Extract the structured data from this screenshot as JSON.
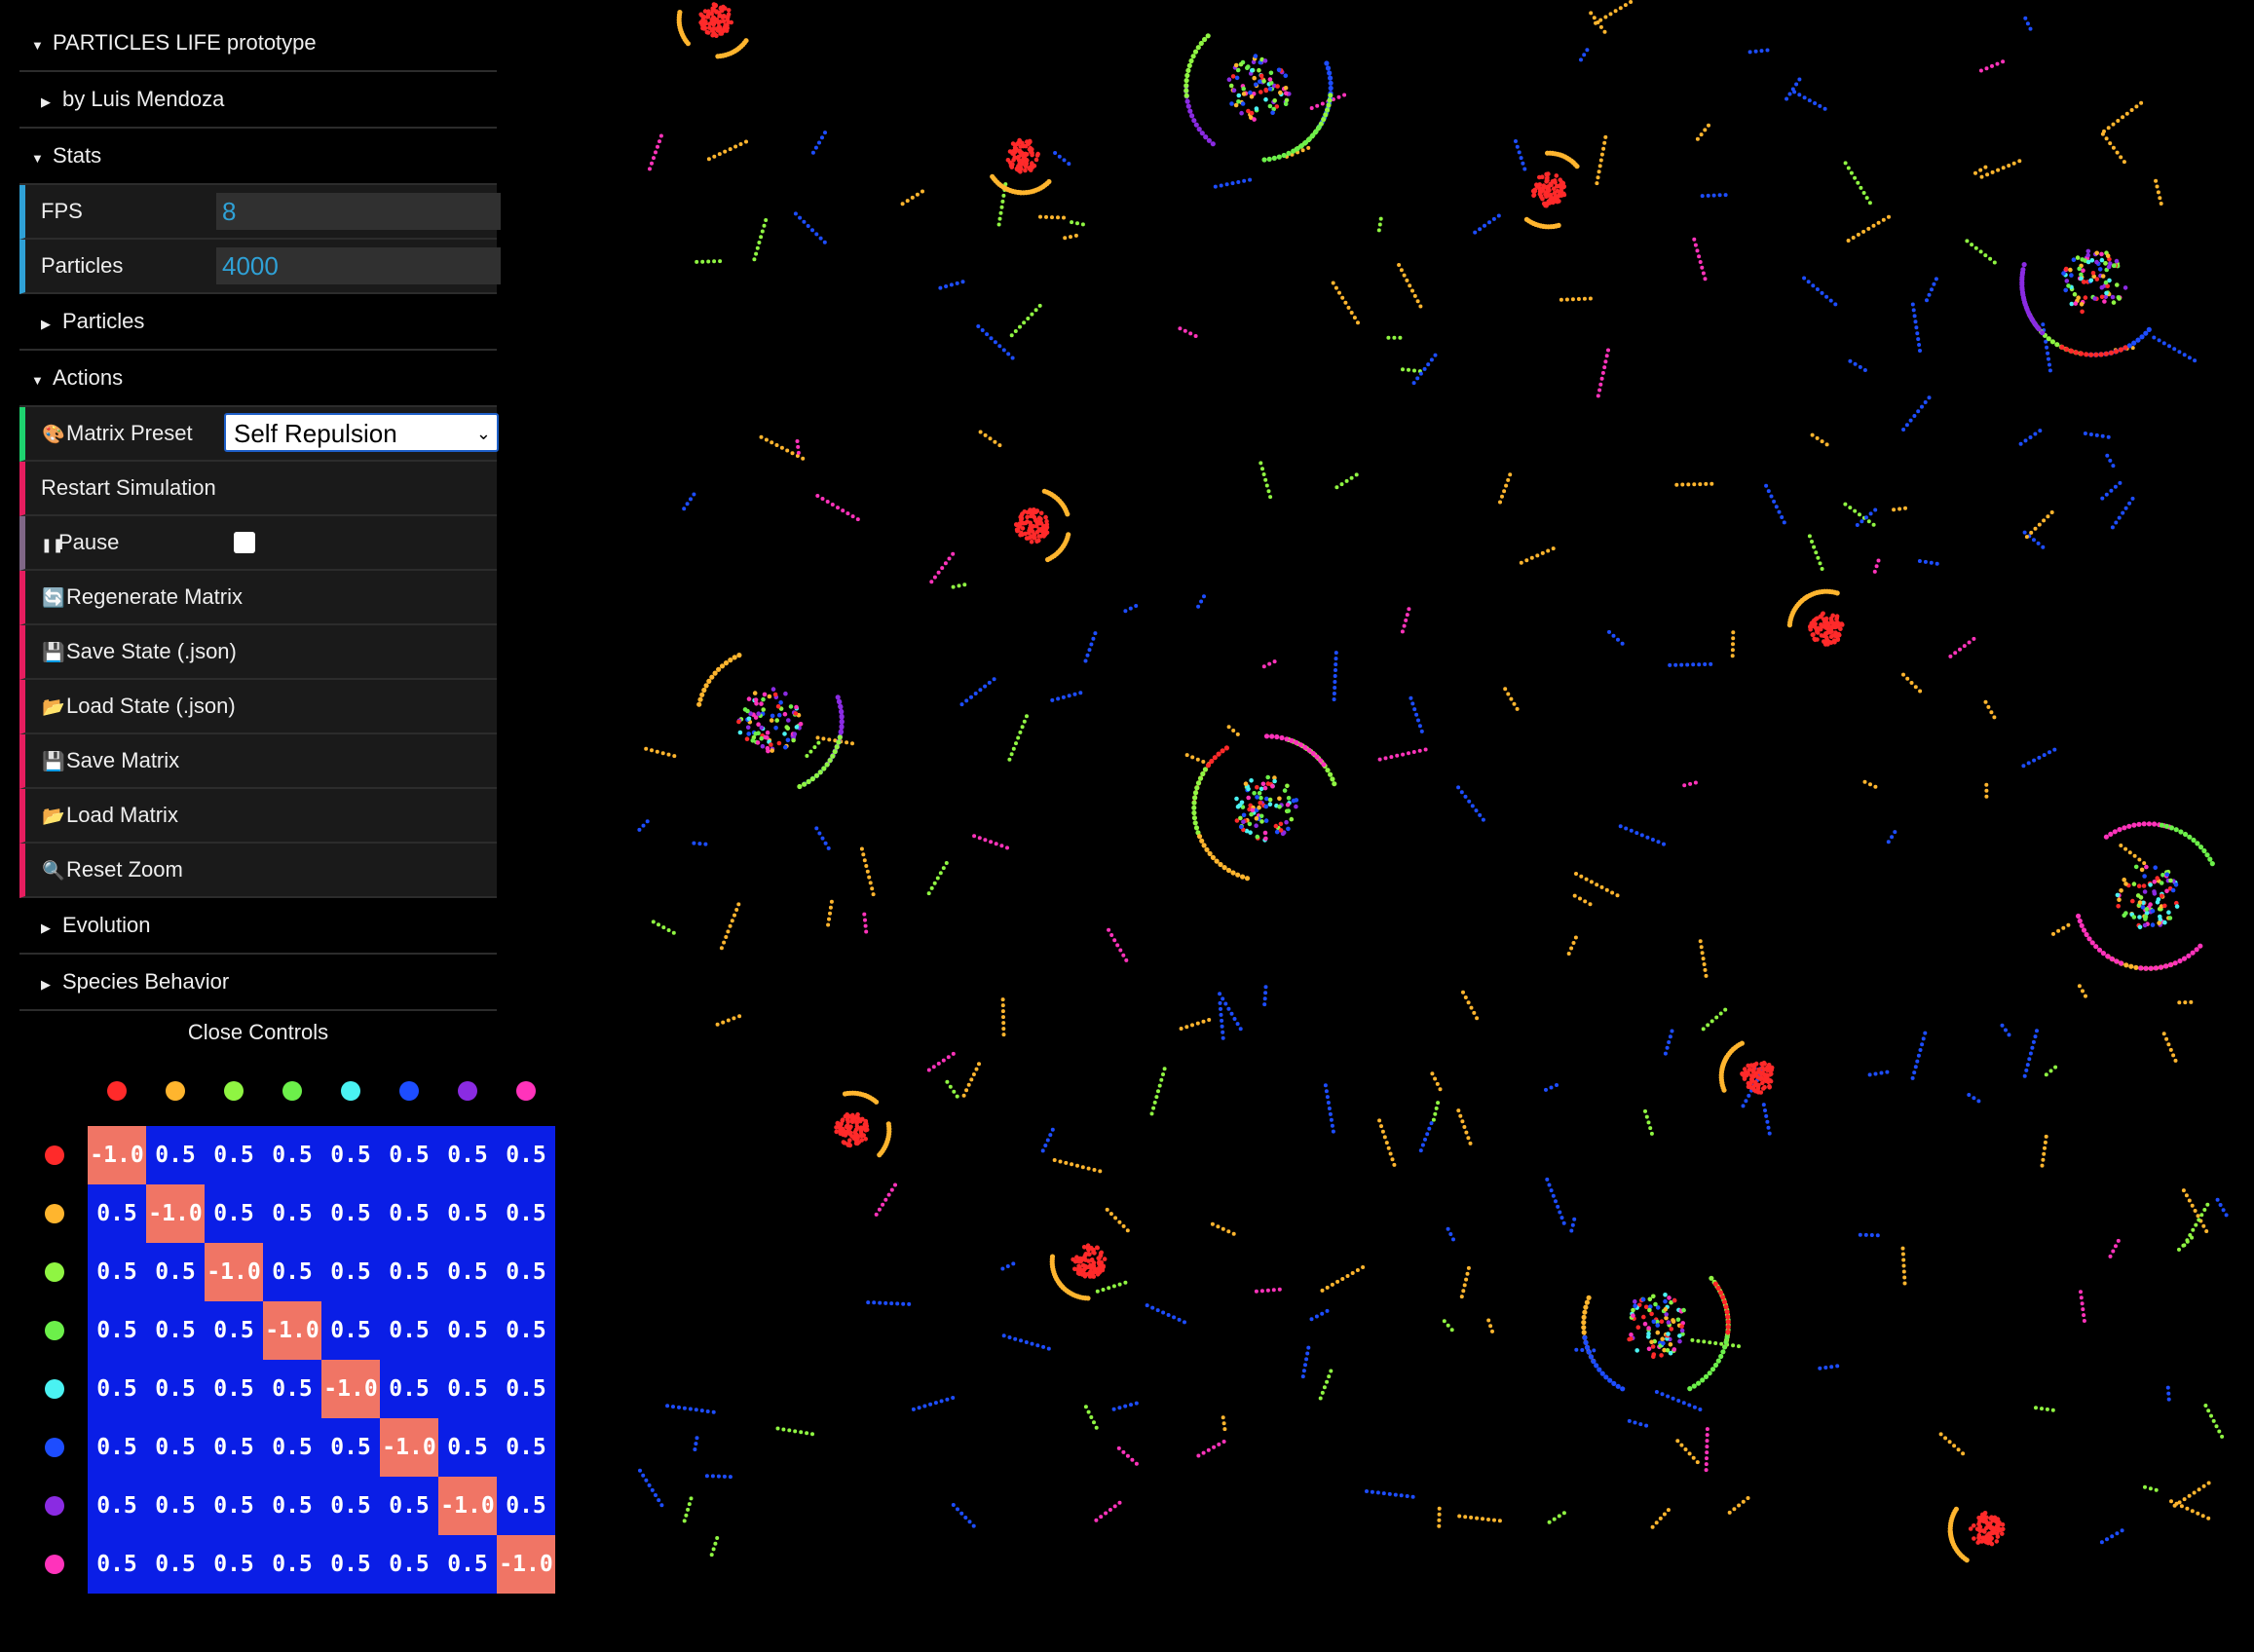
{
  "gui": {
    "title": "PARTICLES LIFE prototype",
    "author": "by Luis Mendoza",
    "stats": {
      "title": "Stats",
      "fps_label": "FPS",
      "fps_value": "8",
      "particles_label": "Particles",
      "particles_value": "4000"
    },
    "particles_folder": "Particles",
    "actions": {
      "title": "Actions",
      "matrix_preset_label": "Matrix Preset",
      "matrix_preset_value": "Self Repulsion",
      "restart": "Restart Simulation",
      "pause": "Pause",
      "regenerate": "Regenerate Matrix",
      "save_state": "Save State (.json)",
      "load_state": "Load State (.json)",
      "save_matrix": "Save Matrix",
      "load_matrix": "Load Matrix",
      "reset_zoom": "Reset Zoom"
    },
    "evolution": "Evolution",
    "species_behavior": "Species Behavior",
    "close_controls": "Close Controls"
  },
  "colors": {
    "positive_cell": "#0a1ee6",
    "negative_cell": "#f07565",
    "species": [
      "#ff2a2a",
      "#ffb52e",
      "#8ff542",
      "#6cf04a",
      "#4af2f2",
      "#1d4dff",
      "#8a2be2",
      "#ff33bb"
    ]
  },
  "matrix": {
    "values": [
      [
        "-1.0",
        "0.5",
        "0.5",
        "0.5",
        "0.5",
        "0.5",
        "0.5",
        "0.5"
      ],
      [
        "0.5",
        "-1.0",
        "0.5",
        "0.5",
        "0.5",
        "0.5",
        "0.5",
        "0.5"
      ],
      [
        "0.5",
        "0.5",
        "-1.0",
        "0.5",
        "0.5",
        "0.5",
        "0.5",
        "0.5"
      ],
      [
        "0.5",
        "0.5",
        "0.5",
        "-1.0",
        "0.5",
        "0.5",
        "0.5",
        "0.5"
      ],
      [
        "0.5",
        "0.5",
        "0.5",
        "0.5",
        "-1.0",
        "0.5",
        "0.5",
        "0.5"
      ],
      [
        "0.5",
        "0.5",
        "0.5",
        "0.5",
        "0.5",
        "-1.0",
        "0.5",
        "0.5"
      ],
      [
        "0.5",
        "0.5",
        "0.5",
        "0.5",
        "0.5",
        "0.5",
        "-1.0",
        "0.5"
      ],
      [
        "0.5",
        "0.5",
        "0.5",
        "0.5",
        "0.5",
        "0.5",
        "0.5",
        "-1.0"
      ]
    ]
  }
}
